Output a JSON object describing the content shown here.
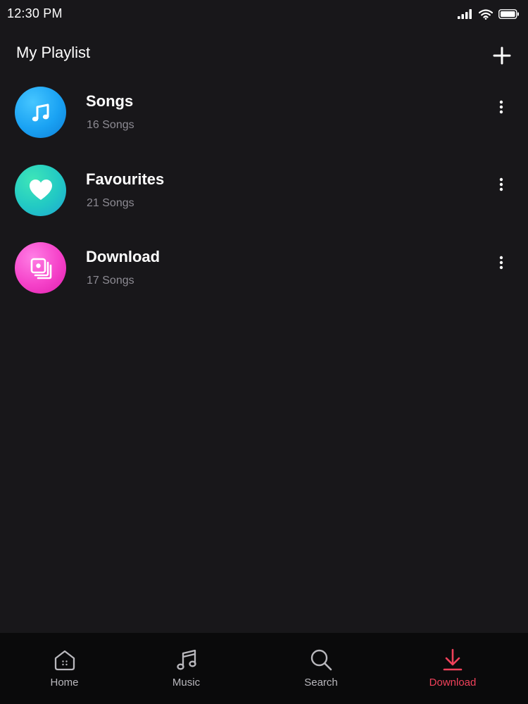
{
  "status_bar": {
    "time": "12:30 PM",
    "icons": [
      "signal-icon",
      "wifi-icon",
      "battery-icon"
    ]
  },
  "header": {
    "title": "My Playlist",
    "add_icon": "plus-icon"
  },
  "playlists": [
    {
      "title": "Songs",
      "subtitle": "16 Songs",
      "icon": "music-note-icon",
      "color": "#1aa2f3"
    },
    {
      "title": "Favourites",
      "subtitle": "21 Songs",
      "icon": "heart-icon",
      "color": "#22c9c4"
    },
    {
      "title": "Download",
      "subtitle": "17 Songs",
      "icon": "album-stack-icon",
      "color": "#f542c9"
    }
  ],
  "tab_bar": {
    "tabs": [
      {
        "label": "Home",
        "icon": "home-icon",
        "active": false
      },
      {
        "label": "Music",
        "icon": "music-icon",
        "active": false
      },
      {
        "label": "Search",
        "icon": "search-icon",
        "active": false
      },
      {
        "label": "Download",
        "icon": "download-icon",
        "active": true
      }
    ],
    "active_color": "#f0415a",
    "inactive_color": "#b9b8bd"
  },
  "colors": {
    "background": "#18171a",
    "tab_bar_background": "#0a0a0b",
    "subtitle": "#8d8b93"
  }
}
